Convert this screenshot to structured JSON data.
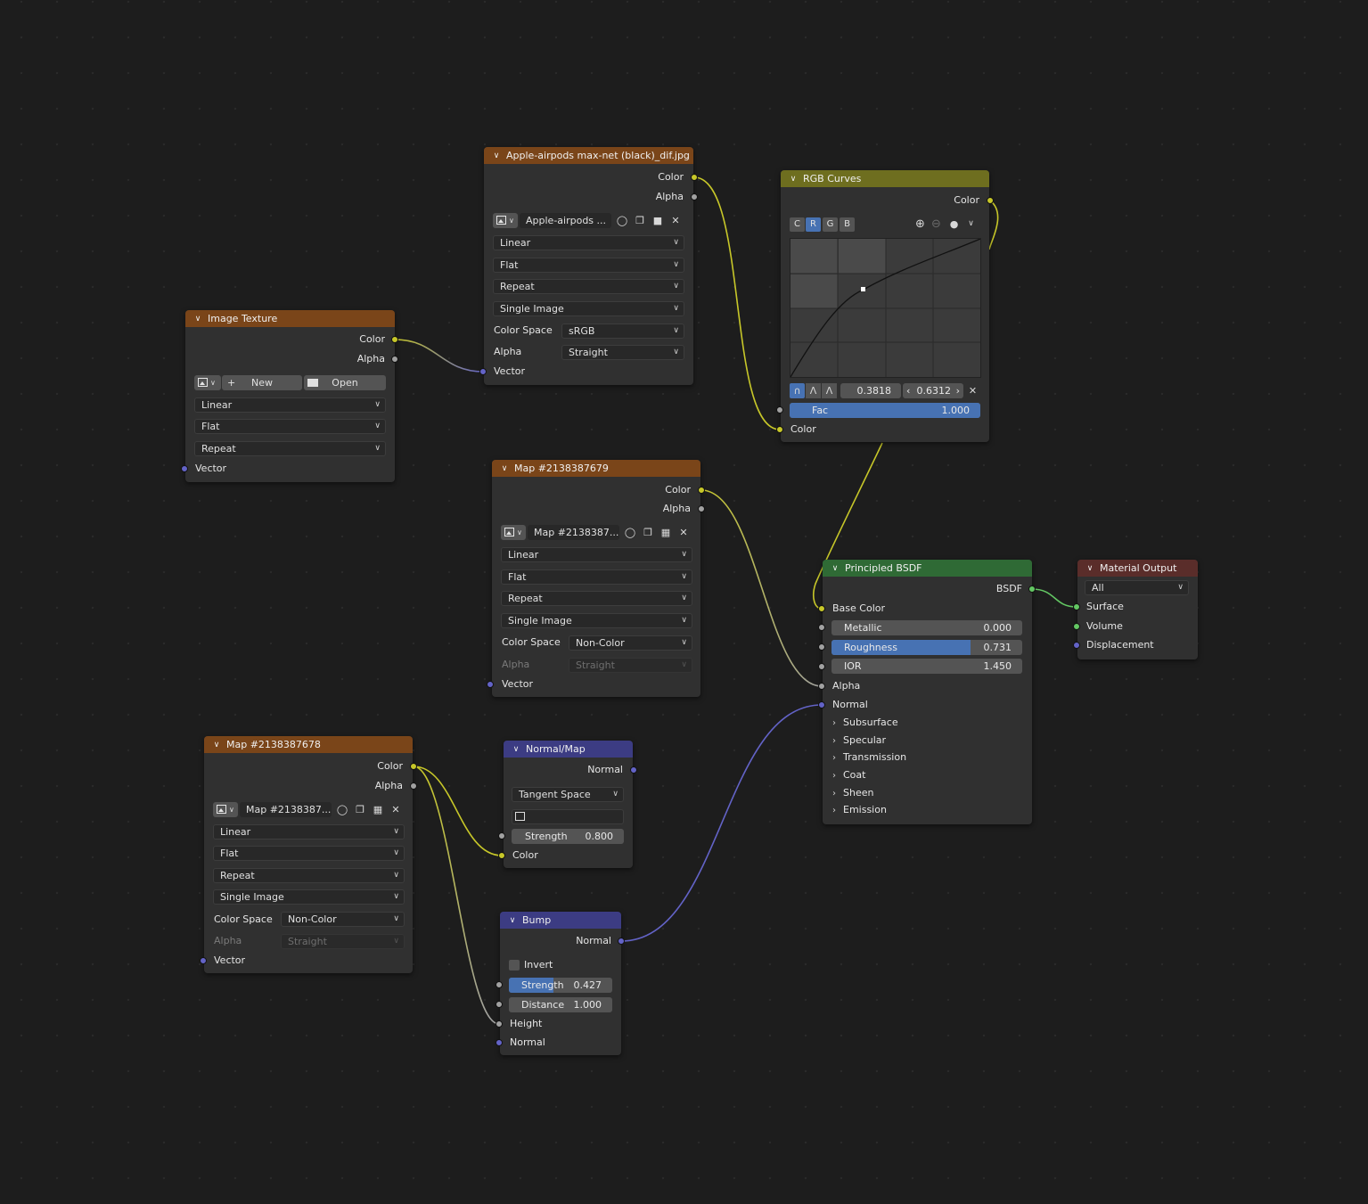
{
  "nodes": {
    "image_texture": {
      "title": "Image Texture",
      "out_color": "Color",
      "out_alpha": "Alpha",
      "new_label": "New",
      "open_label": "Open",
      "interpolation": "Linear",
      "projection": "Flat",
      "extension": "Repeat",
      "in_vector": "Vector"
    },
    "apple_texture": {
      "title": "Apple-airpods max-net (black)_dif.jpg",
      "out_color": "Color",
      "out_alpha": "Alpha",
      "image_name": "Apple-airpods ...",
      "interpolation": "Linear",
      "projection": "Flat",
      "extension": "Repeat",
      "source": "Single Image",
      "color_space_label": "Color Space",
      "color_space": "sRGB",
      "alpha_label": "Alpha",
      "alpha_mode": "Straight",
      "in_vector": "Vector"
    },
    "rgb_curves": {
      "title": "RGB Curves",
      "out_color": "Color",
      "channels": [
        "C",
        "R",
        "G",
        "B"
      ],
      "point_x": "0.3818",
      "point_y": "0.6312",
      "fac_label": "Fac",
      "fac_value": "1.000",
      "fac_fraction": 1.0,
      "in_color": "Color"
    },
    "map_679": {
      "title": "Map #2138387679",
      "out_color": "Color",
      "out_alpha": "Alpha",
      "image_name": "Map #2138387...",
      "interpolation": "Linear",
      "projection": "Flat",
      "extension": "Repeat",
      "source": "Single Image",
      "color_space_label": "Color Space",
      "color_space": "Non-Color",
      "alpha_label": "Alpha",
      "alpha_mode": "Straight",
      "in_vector": "Vector"
    },
    "map_678": {
      "title": "Map #2138387678",
      "out_color": "Color",
      "out_alpha": "Alpha",
      "image_name": "Map #2138387...",
      "interpolation": "Linear",
      "projection": "Flat",
      "extension": "Repeat",
      "source": "Single Image",
      "color_space_label": "Color Space",
      "color_space": "Non-Color",
      "alpha_label": "Alpha",
      "alpha_mode": "Straight",
      "in_vector": "Vector"
    },
    "normal_map": {
      "title": "Normal/Map",
      "out_normal": "Normal",
      "space": "Tangent Space",
      "strength_label": "Strength",
      "strength_value": "0.800",
      "in_color": "Color"
    },
    "bump": {
      "title": "Bump",
      "out_normal": "Normal",
      "invert_label": "Invert",
      "strength_label": "Strength",
      "strength_value": "0.427",
      "strength_fraction": 0.427,
      "distance_label": "Distance",
      "distance_value": "1.000",
      "in_height": "Height",
      "in_normal": "Normal"
    },
    "principled": {
      "title": "Principled BSDF",
      "out_bsdf": "BSDF",
      "base_color": "Base Color",
      "metallic_label": "Metallic",
      "metallic_value": "0.000",
      "roughness_label": "Roughness",
      "roughness_value": "0.731",
      "roughness_fraction": 0.731,
      "ior_label": "IOR",
      "ior_value": "1.450",
      "alpha": "Alpha",
      "normal": "Normal",
      "panels": [
        "Subsurface",
        "Specular",
        "Transmission",
        "Coat",
        "Sheen",
        "Emission"
      ]
    },
    "material_output": {
      "title": "Material Output",
      "target": "All",
      "surface": "Surface",
      "volume": "Volume",
      "displacement": "Displacement"
    }
  },
  "colors": {
    "texture_header": "#7a4519",
    "curve_header": "#6e6e1f",
    "vector_header": "#3c3c83",
    "shader_header": "#2f6a35",
    "output_header": "#5a2d2a",
    "socket_color": "#c7c729",
    "socket_float": "#a1a1a1",
    "socket_vector": "#6363c7",
    "socket_shader": "#63c763",
    "accent": "#4772b3"
  }
}
